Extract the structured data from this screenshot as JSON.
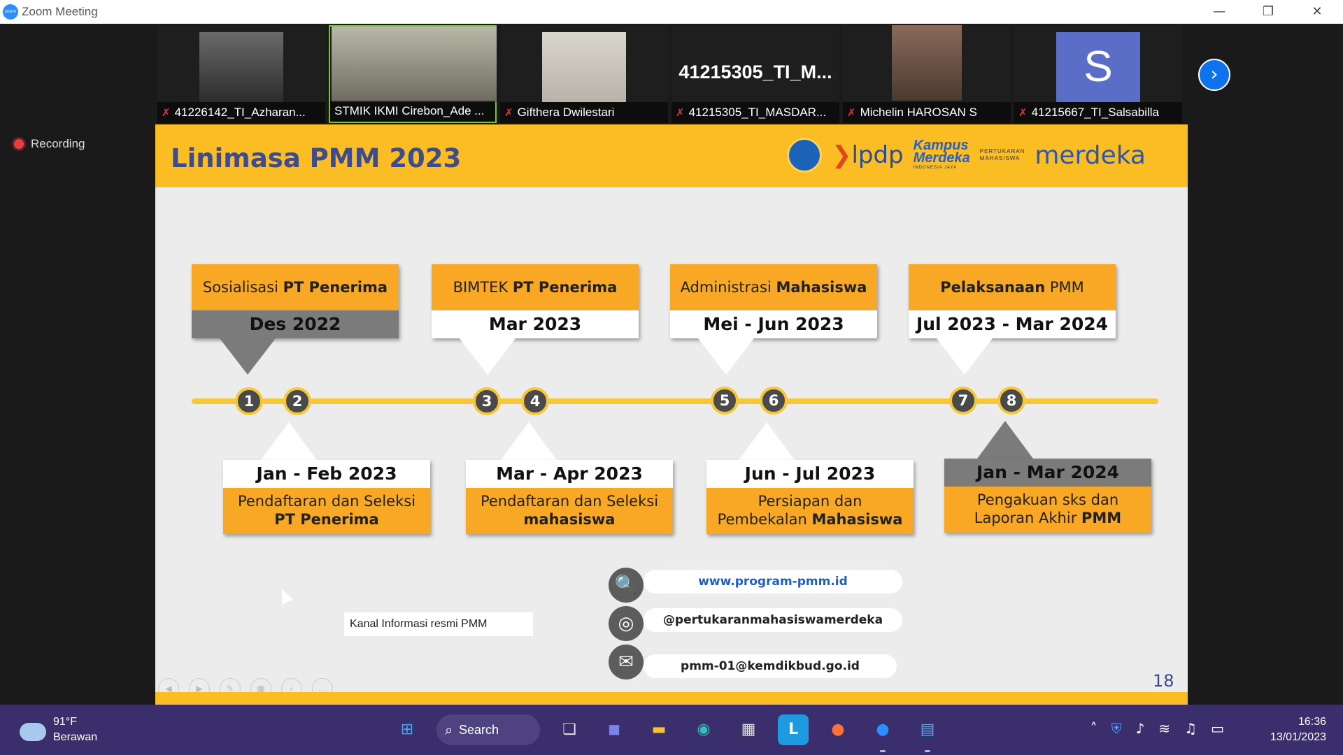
{
  "window": {
    "title": "Zoom Meeting",
    "logo": "zoom"
  },
  "participants": [
    {
      "name": "41226142_TI_Azharan...",
      "muted": true
    },
    {
      "name": "STMIK IKMI Cirebon_Ade ...",
      "muted": false,
      "active": true
    },
    {
      "name": "Gifthera Dwilestari",
      "muted": true
    },
    {
      "name": "41215305_TI_MASDAR...",
      "muted": true,
      "display": "41215305_TI_M..."
    },
    {
      "name": "Michelin HAROSAN S",
      "muted": true
    },
    {
      "name": "41215667_TI_Salsabilla",
      "muted": true,
      "avatar": "S"
    }
  ],
  "recording": "Recording",
  "slide": {
    "title": "Linimasa PMM 2023",
    "logos": {
      "lpdp": "lpdp",
      "kampus": "Kampus",
      "merdeka_km": "Merdeka",
      "indonesia_jaya": "INDONESIA JAYA",
      "pertukaran": "PERTUKARAN",
      "mahasiswa": "MAHASISWA",
      "merdeka": "merdeka"
    },
    "nodes": [
      "1",
      "2",
      "3",
      "4",
      "5",
      "6",
      "7",
      "8"
    ],
    "top_boxes": [
      {
        "label_plain": "Sosialisasi ",
        "label_bold": "PT Penerima",
        "date": "Des  2022"
      },
      {
        "label_plain": "BIMTEK ",
        "label_bold": "PT Penerima",
        "date": "Mar 2023"
      },
      {
        "label_plain": "Administrasi ",
        "label_bold": "Mahasiswa",
        "date": "Mei - Jun 2023"
      },
      {
        "label_plain": " PMM",
        "label_bold": "Pelaksanaan",
        "date": "Jul 2023 - Mar 2024"
      }
    ],
    "bottom_boxes": [
      {
        "date": "Jan - Feb 2023",
        "line1": "Pendaftaran dan Seleksi",
        "line2_plain": "",
        "line2_bold": "PT Penerima"
      },
      {
        "date": "Mar - Apr 2023",
        "line1": "Pendaftaran dan Seleksi",
        "line2_plain": "",
        "line2_bold": "mahasiswa"
      },
      {
        "date": "Jun - Jul 2023",
        "line1": "Persiapan dan",
        "line2_plain": "Pembekalan ",
        "line2_bold": "Mahasiswa"
      },
      {
        "date": "Jan - Mar 2024",
        "line1": "Pengakuan sks dan",
        "line2_plain": "Laporan Akhir ",
        "line2_bold": "PMM"
      }
    ],
    "contacts": {
      "website": "www.program-pmm.id",
      "instagram": "@pertukaranmahasiswamerdeka",
      "email": "pmm-01@kemdikbud.go.id"
    },
    "kanal": "Kanal Informasi resmi PMM",
    "page_number": "18"
  },
  "taskbar": {
    "weather_temp": "91°F",
    "weather_desc": "Berawan",
    "search_label": "Search",
    "time": "16:36",
    "date": "13/01/2023"
  },
  "colors": {
    "slide_yellow": "#fbbd24",
    "box_orange": "#f8a824",
    "title_blue": "#3d4b8f",
    "taskbar": "#3b2e6d",
    "zoom_blue": "#2d8cff"
  }
}
